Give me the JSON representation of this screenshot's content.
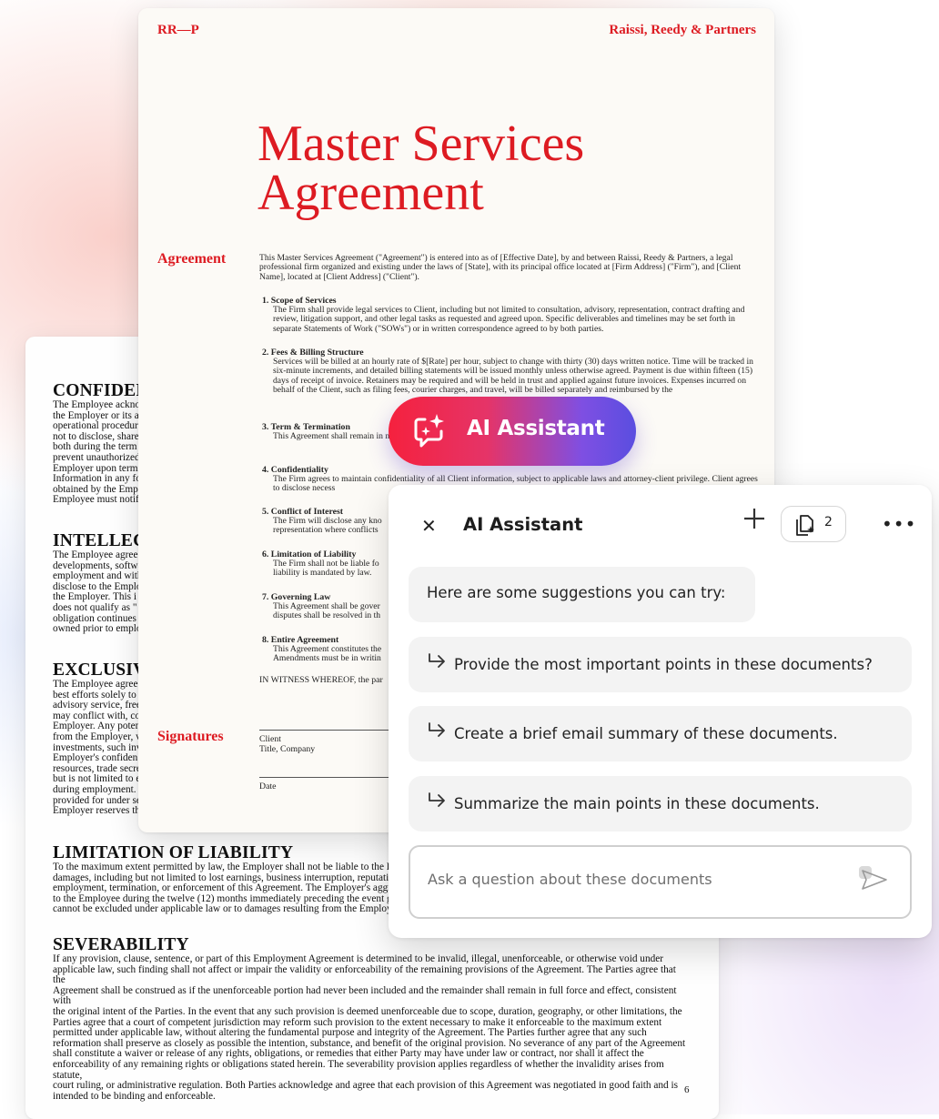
{
  "colors": {
    "accent_red": "#dd1b22",
    "ai_gradient_start": "#f5213e",
    "ai_gradient_end": "#5a4ee0"
  },
  "back_doc": {
    "sections": [
      {
        "heading": "CONFIDEN",
        "lines": [
          "The Employee ackno",
          "the Employer or its a",
          "operational procedur",
          "not to disclose, share",
          "both during the term",
          "prevent unauthorized",
          "Employer upon termi",
          "Information in any fo",
          "obtained by the Empl",
          "Employee must notif"
        ]
      },
      {
        "heading": "INTELLEC",
        "lines": [
          "The Employee agree",
          "developments, softwa",
          "employment and with",
          "disclose to the Emplo",
          "the Employer. This i",
          "does not qualify as \"",
          "obligation continues",
          "owned prior to emplo"
        ]
      },
      {
        "heading": "EXCLUSIV",
        "lines": [
          "The Employee agree",
          "best efforts solely to",
          "advisory service, free",
          "may conflict with, co",
          "Employer. Any poten",
          "from the Employer, v",
          "investments, such inv",
          "Employer's confiden",
          "resources, trade secre",
          "but is not limited to e",
          "during employment.",
          "provided for under se",
          "Employer reserves th"
        ]
      },
      {
        "heading": "LIMITATION OF LIABILITY",
        "lines": [
          "To the maximum extent permitted by law, the Employer shall not be liable to the E",
          "damages, including but not limited to lost earnings, business interruption, reputatio",
          "employment, termination, or enforcement of this Agreement. The Employer's aggr",
          "to the Employee during the twelve (12) months immediately preceding the event g",
          "cannot be excluded under applicable law or to damages resulting from the Employ"
        ]
      },
      {
        "heading": "SEVERABILITY",
        "lines": [
          "If any provision, clause, sentence, or part of this Employment Agreement is determined to be invalid, illegal, unenforceable, or otherwise void under",
          "applicable law, such finding shall not affect or impair the validity or enforceability of the remaining provisions of the Agreement. The Parties agree that the",
          "Agreement shall be construed as if the unenforceable portion had never been included and the remainder shall remain in full force and effect, consistent with",
          "the original intent of the Parties. In the event that any such provision is deemed unenforceable due to scope, duration, geography, or other limitations, the",
          "Parties agree that a court of competent jurisdiction may reform such provision to the extent necessary to make it enforceable to the maximum extent",
          "permitted under applicable law, without altering the fundamental purpose and integrity of the Agreement. The Parties further agree that any such",
          "reformation shall preserve as closely as possible the intention, substance, and benefit of the original provision. No severance of any part of the Agreement",
          "shall constitute a waiver or release of any rights, obligations, or remedies that either Party may have under law or contract, nor shall it affect the",
          "enforceability of any remaining rights or obligations stated herein. The severability provision applies regardless of whether the invalidity arises from statute,",
          "court ruling, or administrative regulation. Both Parties acknowledge and agree that each provision of this Agreement was negotiated in good faith and is",
          "intended to be binding and enforceable."
        ]
      }
    ],
    "page_number": "6"
  },
  "front_doc": {
    "header_left": "RR—P",
    "header_right": "Raissi, Reedy & Partners",
    "title_line1": "Master Services",
    "title_line2": "Agreement",
    "agreement_label": "Agreement",
    "intro": "This Master Services Agreement (\"Agreement\") is entered into as of [Effective Date], by and between Raissi, Reedy & Partners, a legal professional firm organized and existing under the laws of [State], with its principal office located at [Firm Address] (\"Firm\"), and [Client Name], located at [Client Address] (\"Client\").",
    "clauses": [
      {
        "title": "1. Scope of Services",
        "body": "The Firm shall provide legal services to Client, including but not limited to consultation, advisory, representation, contract drafting and review, litigation support, and other legal tasks as requested and agreed upon. Specific deliverables and timelines may be set forth in separate Statements of Work (\"SOWs\") or in written correspondence agreed to by both parties."
      },
      {
        "title": "2. Fees & Billing Structure",
        "body": "Services will be billed at an hourly rate of $[Rate] per hour, subject to change with thirty (30) days written notice. Time will be tracked in six-minute increments, and detailed billing statements will be issued monthly unless otherwise agreed. Payment is due within fifteen (15) days of receipt of invoice. Retainers may be required and will be held in trust and applied against future invoices. Expenses incurred on behalf of the Client, such as filing fees, courier charges, and travel, will be billed separately and reimbursed by the"
      },
      {
        "title": "3. Term & Termination",
        "body": "This Agreement shall remain in                                                                         n notice. The Client will be responsible for any accrued fees"
      },
      {
        "title": "4. Confidentiality",
        "body": "The Firm agrees to maintain confidentiality of all Client information, subject to applicable laws and attorney-client privilege. Client agrees to disclose necess"
      },
      {
        "title": "5. Conflict of Interest",
        "body": "The Firm will disclose any kno representation where conflicts"
      },
      {
        "title": "6. Limitation of Liability",
        "body": "The Firm shall not be liable fo liability is mandated by law."
      },
      {
        "title": "7. Governing Law",
        "body": "This Agreement shall be gover disputes shall be resolved in th"
      },
      {
        "title": "8. Entire Agreement",
        "body": "This Agreement constitutes the Amendments must be in writin"
      }
    ],
    "witness": "IN WITNESS WHEREOF, the par",
    "signatures_label": "Signatures",
    "sig_client": "Client",
    "sig_title": "Title, Company",
    "sig_date": "Date"
  },
  "ai_pill": {
    "label": "AI Assistant",
    "icon": "ai-sparkle-chat-icon"
  },
  "panel": {
    "title": "AI Assistant",
    "doc_count": "2",
    "intro": "Here are some suggestions you can try:",
    "suggestions": [
      "Provide the most important points in these documents?",
      "Create a brief email summary of these documents.",
      "Summarize the main points in these documents."
    ],
    "input_placeholder": "Ask a question about these documents"
  }
}
